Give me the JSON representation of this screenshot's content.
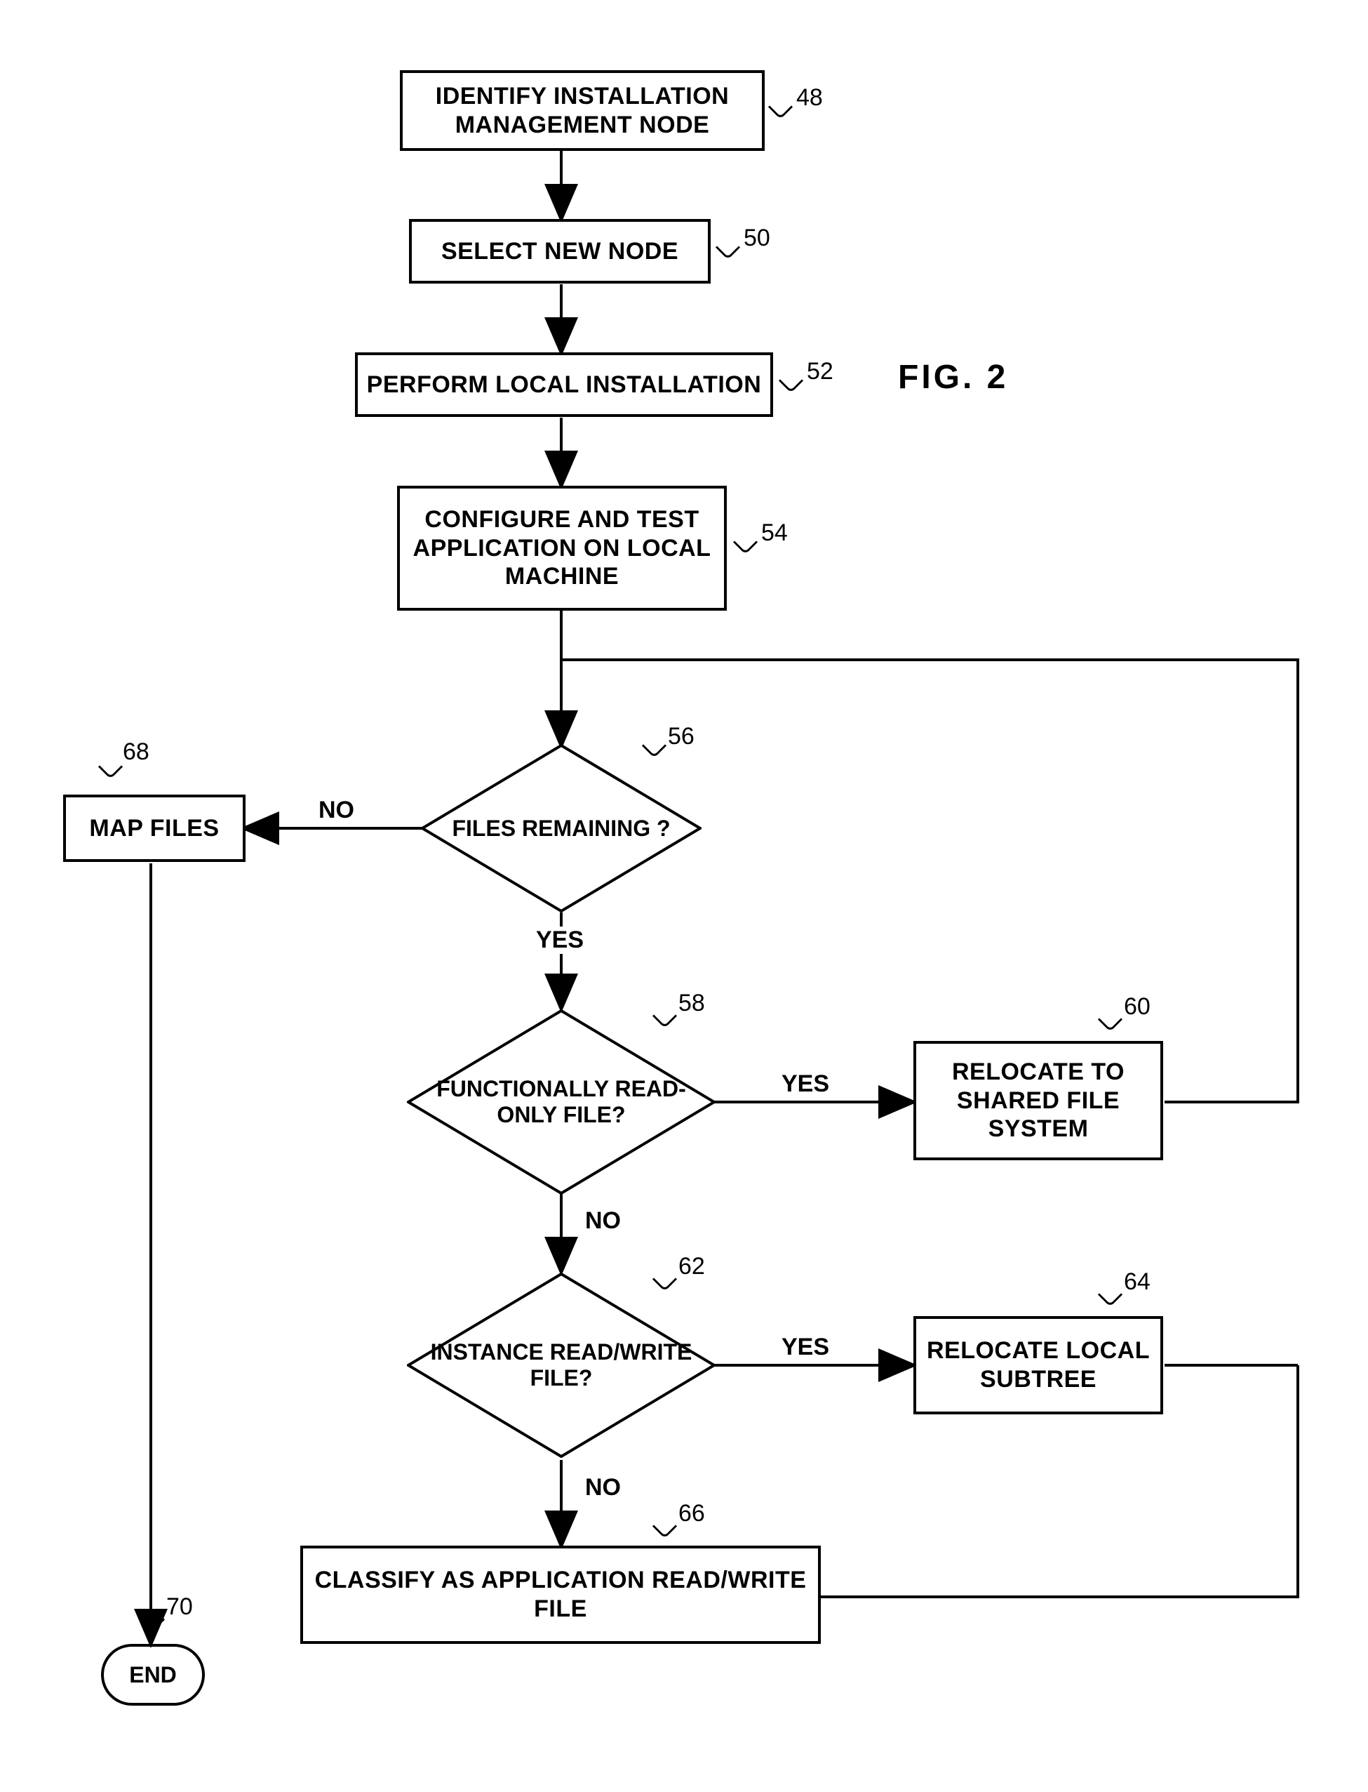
{
  "figure_label": "FIG. 2",
  "nodes": {
    "n48": "IDENTIFY INSTALLATION MANAGEMENT NODE",
    "n50": "SELECT NEW NODE",
    "n52": "PERFORM LOCAL INSTALLATION",
    "n54": "CONFIGURE AND TEST APPLICATION ON LOCAL MACHINE",
    "n56": "FILES REMAINING ?",
    "n58": "FUNCTIONALLY READ-ONLY FILE?",
    "n60": "RELOCATE TO SHARED FILE SYSTEM",
    "n62": "INSTANCE READ/WRITE FILE?",
    "n64": "RELOCATE LOCAL SUBTREE",
    "n66": "CLASSIFY AS APPLICATION READ/WRITE FILE",
    "n68": "MAP FILES",
    "n70": "END"
  },
  "refs": {
    "r48": "48",
    "r50": "50",
    "r52": "52",
    "r54": "54",
    "r56": "56",
    "r58": "58",
    "r60": "60",
    "r62": "62",
    "r64": "64",
    "r66": "66",
    "r68": "68",
    "r70": "70"
  },
  "edges": {
    "yes": "YES",
    "no": "NO"
  }
}
